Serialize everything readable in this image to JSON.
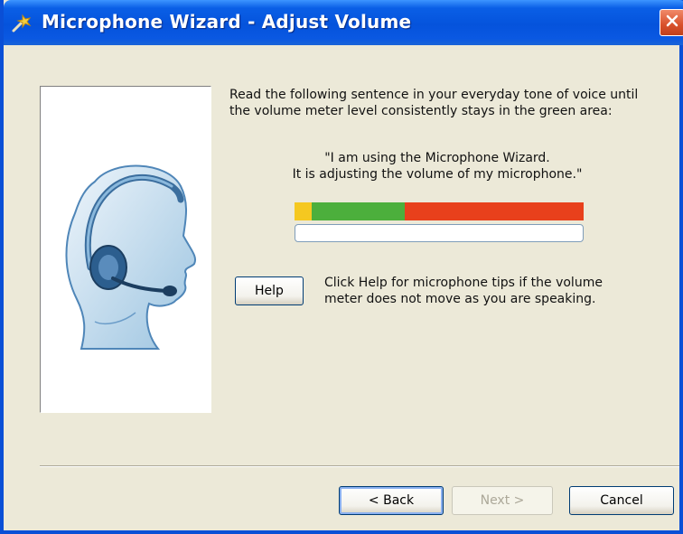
{
  "window": {
    "title": "Microphone Wizard - Adjust Volume",
    "app_icon": "microphone-wizard-icon",
    "close_icon": "close-icon",
    "title_bar_color": "#0553dc",
    "close_button_color": "#d8502a"
  },
  "content": {
    "instruction": "Read the following sentence in your everyday tone of voice until the volume meter level consistently stays in the green area:",
    "quote_line1": "\"I am using the Microphone Wizard.",
    "quote_line2": "It is adjusting the volume of my microphone.\"",
    "illustration_icon": "headset-person-illustration"
  },
  "meter": {
    "zones": [
      {
        "name": "low",
        "color": "#f5c820",
        "fraction": 0.06
      },
      {
        "name": "good",
        "color": "#4caf3c",
        "fraction": 0.32
      },
      {
        "name": "loud",
        "color": "#e8401c",
        "fraction": 0.62
      }
    ],
    "level": 0
  },
  "help": {
    "button_label": "Help",
    "text_line1": "Click Help for microphone tips if the volume",
    "text_line2": "meter does not move as you are speaking."
  },
  "footer": {
    "back_label": "< Back",
    "next_label": "Next >",
    "cancel_label": "Cancel"
  }
}
